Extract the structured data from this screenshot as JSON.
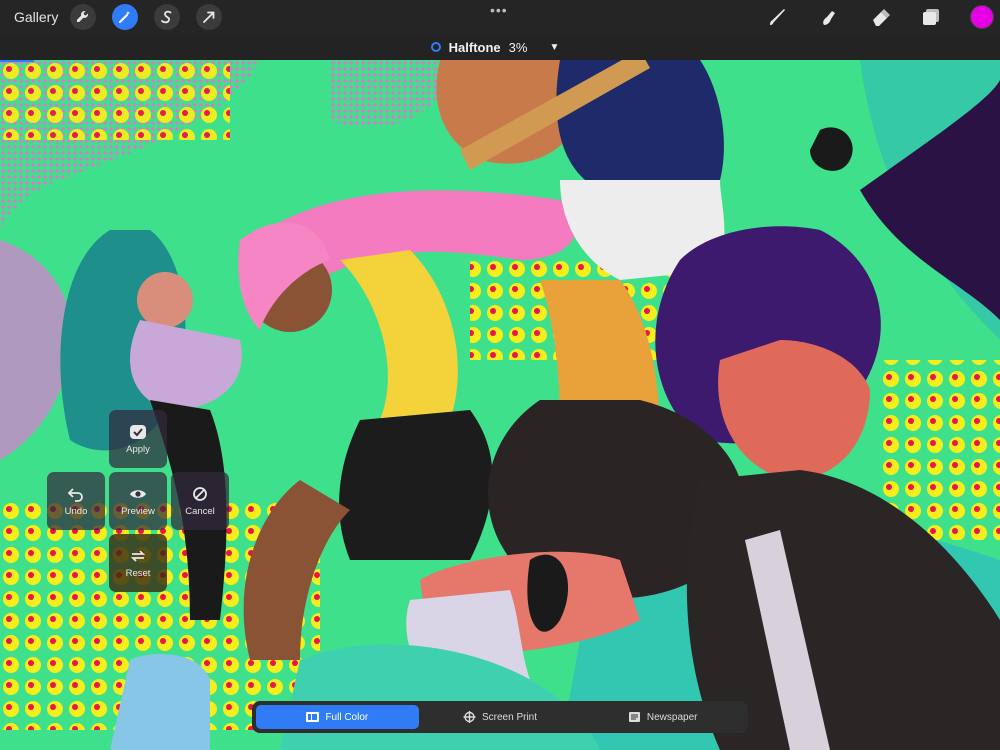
{
  "toolbar": {
    "gallery_label": "Gallery",
    "left_tools": [
      {
        "icon": "wrench-icon"
      },
      {
        "icon": "magic-wand-icon",
        "active": true
      },
      {
        "icon": "selection-s-icon"
      },
      {
        "icon": "arrow-cursor-icon"
      }
    ],
    "more_label": "•••",
    "right_tools": [
      {
        "icon": "brush-icon"
      },
      {
        "icon": "smudge-icon"
      },
      {
        "icon": "eraser-icon"
      },
      {
        "icon": "layers-icon"
      }
    ],
    "current_color": "#e600e6"
  },
  "adjustment": {
    "name": "Halftone",
    "percent": "3%",
    "accent": "#2f7cf6"
  },
  "quick_menu": {
    "apply_label": "Apply",
    "undo_label": "Undo",
    "preview_label": "Preview",
    "cancel_label": "Cancel",
    "reset_label": "Reset"
  },
  "modes": [
    {
      "label": "Full Color",
      "icon": "full-color-icon",
      "selected": true
    },
    {
      "label": "Screen Print",
      "icon": "screen-print-icon",
      "selected": false
    },
    {
      "label": "Newspaper",
      "icon": "newspaper-icon",
      "selected": false
    }
  ]
}
